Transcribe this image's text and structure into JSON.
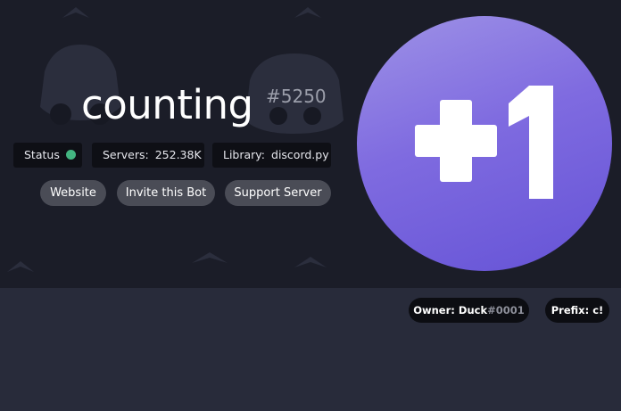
{
  "bot": {
    "name": "counting",
    "discriminator": "#5250"
  },
  "stats": {
    "status_label": "Status",
    "status_color": "#43b581",
    "servers_label": "Servers:",
    "servers_value": "252.38K",
    "library_label": "Library:",
    "library_value": "discord.py"
  },
  "buttons": {
    "website": "Website",
    "invite": "Invite this Bot",
    "support": "Support Server"
  },
  "avatar": {
    "text": "+1",
    "gradient": [
      "#9e92e6",
      "#6553d6"
    ]
  },
  "owner": {
    "label": "Owner:",
    "name": "Duck",
    "discriminator": "#0001"
  },
  "prefix": {
    "label": "Prefix:",
    "value": "c!"
  },
  "colors": {
    "hero_background": "#1b1d28",
    "lower_background": "#282b3a",
    "pattern": "#2d3040"
  }
}
